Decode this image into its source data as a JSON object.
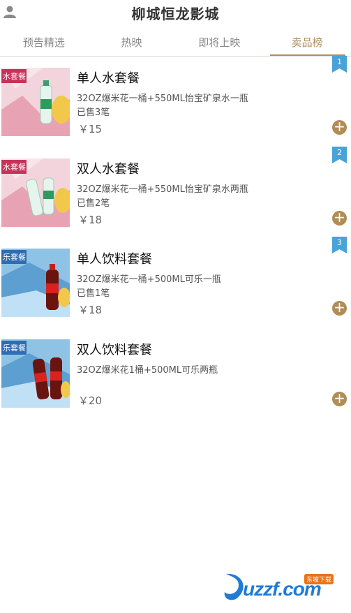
{
  "header": {
    "title": "柳城恒龙影城",
    "user_icon": "user-icon"
  },
  "tabs": [
    {
      "label": "预告精选",
      "active": false
    },
    {
      "label": "热映",
      "active": false
    },
    {
      "label": "即将上映",
      "active": false
    },
    {
      "label": "卖品榜",
      "active": true
    }
  ],
  "products": [
    {
      "rank": "1",
      "name": "单人水套餐",
      "desc": "32OZ爆米花一桶+550ML怡宝矿泉水一瓶",
      "sold": "已售3笔",
      "price": "￥15",
      "image": "water-combo",
      "banner": "水套餐"
    },
    {
      "rank": "2",
      "name": "双人水套餐",
      "desc": "32OZ爆米花一桶+550ML怡宝矿泉水两瓶",
      "sold": "已售2笔",
      "price": "￥18",
      "image": "water-combo-double",
      "banner": "水套餐"
    },
    {
      "rank": "3",
      "name": "单人饮料套餐",
      "desc": "32OZ爆米花一桶+500ML可乐一瓶",
      "sold": "已售1笔",
      "price": "￥18",
      "image": "cola-combo",
      "banner": "乐套餐"
    },
    {
      "rank": "",
      "name": "双人饮料套餐",
      "desc": "32OZ爆米花1桶+500ML可乐两瓶",
      "sold": "",
      "price": "￥20",
      "image": "cola-combo-double",
      "banner": "乐套餐"
    }
  ],
  "colors": {
    "accent": "#b08d57",
    "rank_badge": "#4aa3d8"
  },
  "watermark": {
    "text": "uzzf.com",
    "tag": "东坡下载"
  }
}
